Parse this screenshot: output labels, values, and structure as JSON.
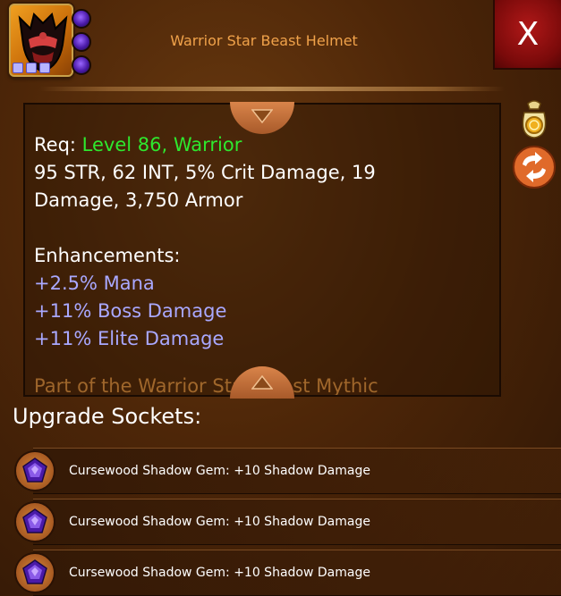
{
  "header": {
    "title": "Warrior Star Beast Helmet",
    "close_label": "X"
  },
  "item": {
    "icon": "helmet-icon",
    "socket_count": 3,
    "pip_count": 3
  },
  "description": {
    "req_label": "Req: ",
    "req_level": "Level 86",
    "req_sep": ", ",
    "req_class": "Warrior",
    "stats_line1": "95 STR, 62 INT, 5% Crit Damage, 19",
    "stats_line2": "Damage, 3,750 Armor",
    "enhancements_title": "Enhancements:",
    "enhancements": [
      "+2.5% Mana",
      "+11% Boss Damage",
      "+11% Elite Damage"
    ],
    "overflow_text": "Part of the Warrior Star Beast Mythic"
  },
  "side_buttons": {
    "sell_icon": "gold-bag-icon",
    "swap_icon": "swap-arrows-icon"
  },
  "sockets": {
    "title": "Upgrade Sockets:",
    "items": [
      {
        "label": "Cursewood Shadow Gem: +10 Shadow Damage",
        "icon": "shadow-gem-icon"
      },
      {
        "label": "Cursewood Shadow Gem: +10 Shadow Damage",
        "icon": "shadow-gem-icon"
      },
      {
        "label": "Cursewood Shadow Gem: +10 Shadow Damage",
        "icon": "shadow-gem-icon"
      }
    ]
  },
  "colors": {
    "title": "#f0a24a",
    "requirement": "#2ee82e",
    "enhancement": "#a9a8ff",
    "close_bg": "#9a1010"
  }
}
